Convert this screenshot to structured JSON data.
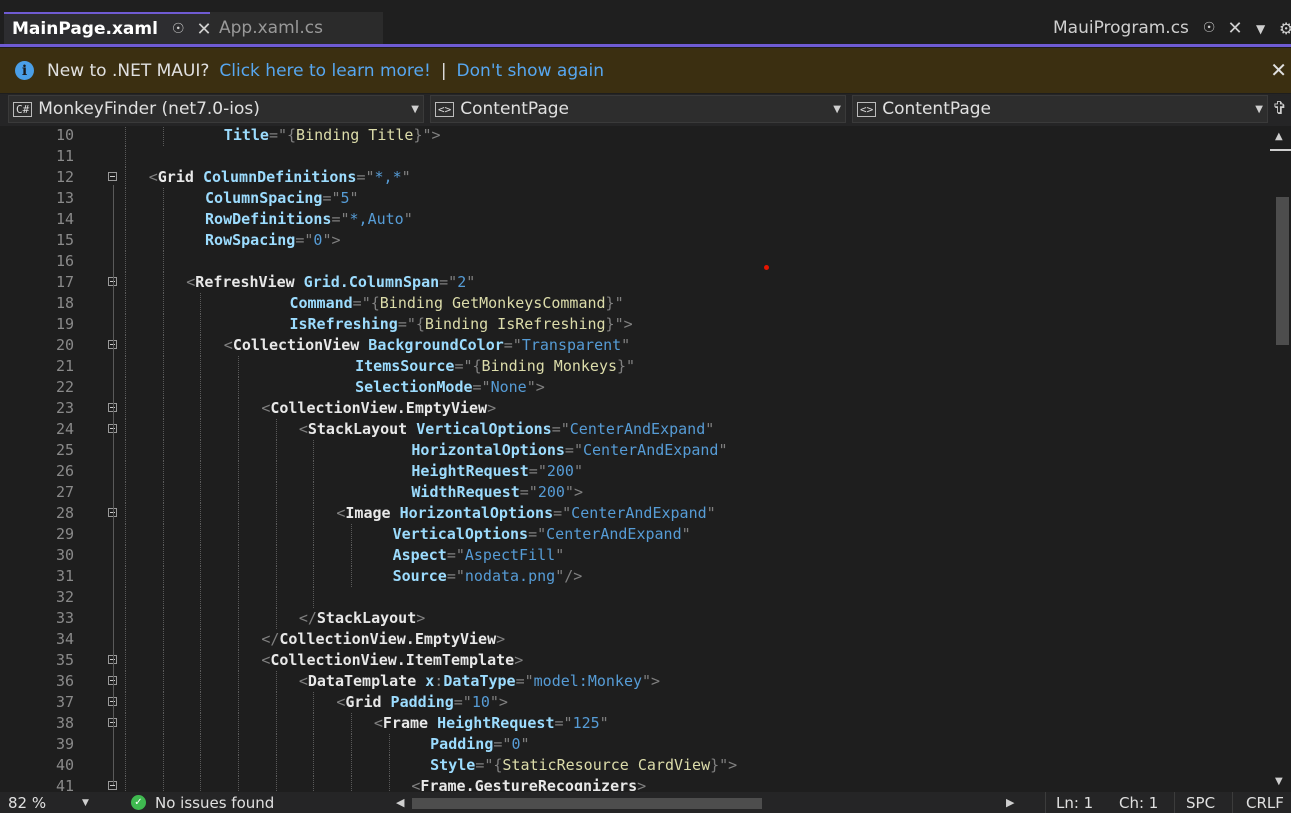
{
  "tabs": {
    "active": {
      "label": "MainPage.xaml"
    },
    "inactive": {
      "label": "App.xaml.cs"
    },
    "right": {
      "label": "MauiProgram.cs"
    }
  },
  "infobar": {
    "message": "New to .NET MAUI?",
    "link_learn": "Click here to learn more!",
    "separator": "|",
    "link_dismiss": "Don't show again"
  },
  "navbar": {
    "project": "MonkeyFinder (net7.0-ios)",
    "type": "ContentPage",
    "member": "ContentPage"
  },
  "editor": {
    "lines": [
      {
        "n": "10",
        "fold": false,
        "indent": 10,
        "guides": [
          0,
          1
        ],
        "tokens": [
          [
            "a",
            "Title"
          ],
          [
            "p",
            "=\""
          ],
          [
            "p",
            "{"
          ],
          [
            "x",
            "Binding Title"
          ],
          [
            "p",
            "}\">"
          ]
        ]
      },
      {
        "n": "11",
        "fold": false,
        "indent": 0,
        "guides": [
          0
        ],
        "tokens": []
      },
      {
        "n": "12",
        "fold": true,
        "indent": 2,
        "guides": [
          0
        ],
        "tokens": [
          [
            "p",
            "<"
          ],
          [
            "e",
            "Grid"
          ],
          [
            "t",
            " "
          ],
          [
            "a",
            "ColumnDefinitions"
          ],
          [
            "p",
            "=\""
          ],
          [
            "v",
            "*,*"
          ],
          [
            "p",
            "\""
          ]
        ]
      },
      {
        "n": "13",
        "fold": false,
        "indent": 8,
        "guides": [
          0,
          1
        ],
        "tokens": [
          [
            "a",
            "ColumnSpacing"
          ],
          [
            "p",
            "=\""
          ],
          [
            "v",
            "5"
          ],
          [
            "p",
            "\""
          ]
        ]
      },
      {
        "n": "14",
        "fold": false,
        "indent": 8,
        "guides": [
          0,
          1
        ],
        "tokens": [
          [
            "a",
            "RowDefinitions"
          ],
          [
            "p",
            "=\""
          ],
          [
            "v",
            "*,Auto"
          ],
          [
            "p",
            "\""
          ]
        ]
      },
      {
        "n": "15",
        "fold": false,
        "indent": 8,
        "guides": [
          0,
          1
        ],
        "tokens": [
          [
            "a",
            "RowSpacing"
          ],
          [
            "p",
            "=\""
          ],
          [
            "v",
            "0"
          ],
          [
            "p",
            "\">"
          ]
        ]
      },
      {
        "n": "16",
        "fold": false,
        "indent": 0,
        "guides": [
          0,
          1
        ],
        "tokens": []
      },
      {
        "n": "17",
        "fold": true,
        "indent": 6,
        "guides": [
          0,
          1
        ],
        "tokens": [
          [
            "p",
            "<"
          ],
          [
            "e",
            "RefreshView"
          ],
          [
            "t",
            " "
          ],
          [
            "a",
            "Grid.ColumnSpan"
          ],
          [
            "p",
            "=\""
          ],
          [
            "v",
            "2"
          ],
          [
            "p",
            "\""
          ]
        ]
      },
      {
        "n": "18",
        "fold": false,
        "indent": 17,
        "guides": [
          0,
          1,
          2
        ],
        "tokens": [
          [
            "a",
            "Command"
          ],
          [
            "p",
            "=\""
          ],
          [
            "p",
            "{"
          ],
          [
            "x",
            "Binding GetMonkeysCommand"
          ],
          [
            "p",
            "}\""
          ]
        ]
      },
      {
        "n": "19",
        "fold": false,
        "indent": 17,
        "guides": [
          0,
          1,
          2
        ],
        "tokens": [
          [
            "a",
            "IsRefreshing"
          ],
          [
            "p",
            "=\""
          ],
          [
            "p",
            "{"
          ],
          [
            "x",
            "Binding IsRefreshing"
          ],
          [
            "p",
            "}\">"
          ]
        ]
      },
      {
        "n": "20",
        "fold": true,
        "indent": 10,
        "guides": [
          0,
          1,
          2
        ],
        "tokens": [
          [
            "p",
            "<"
          ],
          [
            "e",
            "CollectionView"
          ],
          [
            "t",
            " "
          ],
          [
            "a",
            "BackgroundColor"
          ],
          [
            "p",
            "=\""
          ],
          [
            "v",
            "Transparent"
          ],
          [
            "p",
            "\""
          ]
        ]
      },
      {
        "n": "21",
        "fold": false,
        "indent": 24,
        "guides": [
          0,
          1,
          2,
          3
        ],
        "tokens": [
          [
            "a",
            "ItemsSource"
          ],
          [
            "p",
            "=\""
          ],
          [
            "p",
            "{"
          ],
          [
            "x",
            "Binding Monkeys"
          ],
          [
            "p",
            "}\""
          ]
        ]
      },
      {
        "n": "22",
        "fold": false,
        "indent": 24,
        "guides": [
          0,
          1,
          2,
          3
        ],
        "tokens": [
          [
            "a",
            "SelectionMode"
          ],
          [
            "p",
            "=\""
          ],
          [
            "v",
            "None"
          ],
          [
            "p",
            "\">"
          ]
        ]
      },
      {
        "n": "23",
        "fold": true,
        "indent": 14,
        "guides": [
          0,
          1,
          2,
          3
        ],
        "tokens": [
          [
            "p",
            "<"
          ],
          [
            "e",
            "CollectionView.EmptyView"
          ],
          [
            "p",
            ">"
          ]
        ]
      },
      {
        "n": "24",
        "fold": true,
        "indent": 18,
        "guides": [
          0,
          1,
          2,
          3,
          4
        ],
        "tokens": [
          [
            "p",
            "<"
          ],
          [
            "e",
            "StackLayout"
          ],
          [
            "t",
            " "
          ],
          [
            "a",
            "VerticalOptions"
          ],
          [
            "p",
            "=\""
          ],
          [
            "v",
            "CenterAndExpand"
          ],
          [
            "p",
            "\""
          ]
        ]
      },
      {
        "n": "25",
        "fold": false,
        "indent": 30,
        "guides": [
          0,
          1,
          2,
          3,
          4,
          5
        ],
        "tokens": [
          [
            "a",
            "HorizontalOptions"
          ],
          [
            "p",
            "=\""
          ],
          [
            "v",
            "CenterAndExpand"
          ],
          [
            "p",
            "\""
          ]
        ]
      },
      {
        "n": "26",
        "fold": false,
        "indent": 30,
        "guides": [
          0,
          1,
          2,
          3,
          4,
          5
        ],
        "tokens": [
          [
            "a",
            "HeightRequest"
          ],
          [
            "p",
            "=\""
          ],
          [
            "v",
            "200"
          ],
          [
            "p",
            "\""
          ]
        ]
      },
      {
        "n": "27",
        "fold": false,
        "indent": 30,
        "guides": [
          0,
          1,
          2,
          3,
          4,
          5
        ],
        "tokens": [
          [
            "a",
            "WidthRequest"
          ],
          [
            "p",
            "=\""
          ],
          [
            "v",
            "200"
          ],
          [
            "p",
            "\">"
          ]
        ]
      },
      {
        "n": "28",
        "fold": true,
        "indent": 22,
        "guides": [
          0,
          1,
          2,
          3,
          4,
          5
        ],
        "tokens": [
          [
            "p",
            "<"
          ],
          [
            "e",
            "Image"
          ],
          [
            "t",
            " "
          ],
          [
            "a",
            "HorizontalOptions"
          ],
          [
            "p",
            "=\""
          ],
          [
            "v",
            "CenterAndExpand"
          ],
          [
            "p",
            "\""
          ]
        ]
      },
      {
        "n": "29",
        "fold": false,
        "indent": 28,
        "guides": [
          0,
          1,
          2,
          3,
          4,
          5,
          6
        ],
        "tokens": [
          [
            "a",
            "VerticalOptions"
          ],
          [
            "p",
            "=\""
          ],
          [
            "v",
            "CenterAndExpand"
          ],
          [
            "p",
            "\""
          ]
        ]
      },
      {
        "n": "30",
        "fold": false,
        "indent": 28,
        "guides": [
          0,
          1,
          2,
          3,
          4,
          5,
          6
        ],
        "tokens": [
          [
            "a",
            "Aspect"
          ],
          [
            "p",
            "=\""
          ],
          [
            "v",
            "AspectFill"
          ],
          [
            "p",
            "\""
          ]
        ]
      },
      {
        "n": "31",
        "fold": false,
        "indent": 28,
        "guides": [
          0,
          1,
          2,
          3,
          4,
          5,
          6
        ],
        "tokens": [
          [
            "a",
            "Source"
          ],
          [
            "p",
            "=\""
          ],
          [
            "v",
            "nodata.png"
          ],
          [
            "p",
            "\"/>"
          ]
        ]
      },
      {
        "n": "32",
        "fold": false,
        "indent": 0,
        "guides": [
          0,
          1,
          2,
          3,
          4,
          5
        ],
        "tokens": []
      },
      {
        "n": "33",
        "fold": false,
        "indent": 18,
        "guides": [
          0,
          1,
          2,
          3,
          4
        ],
        "tokens": [
          [
            "p",
            "</"
          ],
          [
            "e",
            "StackLayout"
          ],
          [
            "p",
            ">"
          ]
        ]
      },
      {
        "n": "34",
        "fold": false,
        "indent": 14,
        "guides": [
          0,
          1,
          2,
          3
        ],
        "tokens": [
          [
            "p",
            "</"
          ],
          [
            "e",
            "CollectionView.EmptyView"
          ],
          [
            "p",
            ">"
          ]
        ]
      },
      {
        "n": "35",
        "fold": true,
        "indent": 14,
        "guides": [
          0,
          1,
          2,
          3
        ],
        "tokens": [
          [
            "p",
            "<"
          ],
          [
            "e",
            "CollectionView.ItemTemplate"
          ],
          [
            "p",
            ">"
          ]
        ]
      },
      {
        "n": "36",
        "fold": true,
        "indent": 18,
        "guides": [
          0,
          1,
          2,
          3,
          4
        ],
        "tokens": [
          [
            "p",
            "<"
          ],
          [
            "e",
            "DataTemplate"
          ],
          [
            "t",
            " "
          ],
          [
            "a",
            "x"
          ],
          [
            "p",
            ":"
          ],
          [
            "a",
            "DataType"
          ],
          [
            "p",
            "=\""
          ],
          [
            "v",
            "model:Monkey"
          ],
          [
            "p",
            "\">"
          ]
        ]
      },
      {
        "n": "37",
        "fold": true,
        "indent": 22,
        "guides": [
          0,
          1,
          2,
          3,
          4,
          5
        ],
        "tokens": [
          [
            "p",
            "<"
          ],
          [
            "e",
            "Grid"
          ],
          [
            "t",
            " "
          ],
          [
            "a",
            "Padding"
          ],
          [
            "p",
            "=\""
          ],
          [
            "v",
            "10"
          ],
          [
            "p",
            "\">"
          ]
        ]
      },
      {
        "n": "38",
        "fold": true,
        "indent": 26,
        "guides": [
          0,
          1,
          2,
          3,
          4,
          5,
          6
        ],
        "tokens": [
          [
            "p",
            "<"
          ],
          [
            "e",
            "Frame"
          ],
          [
            "t",
            " "
          ],
          [
            "a",
            "HeightRequest"
          ],
          [
            "p",
            "=\""
          ],
          [
            "v",
            "125"
          ],
          [
            "p",
            "\""
          ]
        ]
      },
      {
        "n": "39",
        "fold": false,
        "indent": 32,
        "guides": [
          0,
          1,
          2,
          3,
          4,
          5,
          6,
          7
        ],
        "tokens": [
          [
            "a",
            "Padding"
          ],
          [
            "p",
            "=\""
          ],
          [
            "v",
            "0"
          ],
          [
            "p",
            "\""
          ]
        ]
      },
      {
        "n": "40",
        "fold": false,
        "indent": 32,
        "guides": [
          0,
          1,
          2,
          3,
          4,
          5,
          6,
          7
        ],
        "tokens": [
          [
            "a",
            "Style"
          ],
          [
            "p",
            "=\""
          ],
          [
            "p",
            "{"
          ],
          [
            "x",
            "StaticResource CardView"
          ],
          [
            "p",
            "}\">"
          ]
        ]
      },
      {
        "n": "41",
        "fold": true,
        "indent": 30,
        "guides": [
          0,
          1,
          2,
          3,
          4,
          5,
          6,
          7
        ],
        "tokens": [
          [
            "p",
            "<"
          ],
          [
            "e",
            "Frame.GestureRecognizers"
          ],
          [
            "p",
            ">"
          ]
        ]
      }
    ]
  },
  "statusbar": {
    "zoom": "82 %",
    "issues": "No issues found",
    "line": "Ln: 1",
    "char": "Ch: 1",
    "spacing": "SPC",
    "line_ending": "CRLF"
  },
  "colors": {
    "accent": "#6f5bd3",
    "infobar_bg": "#3b2f11",
    "link": "#57a7f0",
    "ok": "#3fb950"
  }
}
